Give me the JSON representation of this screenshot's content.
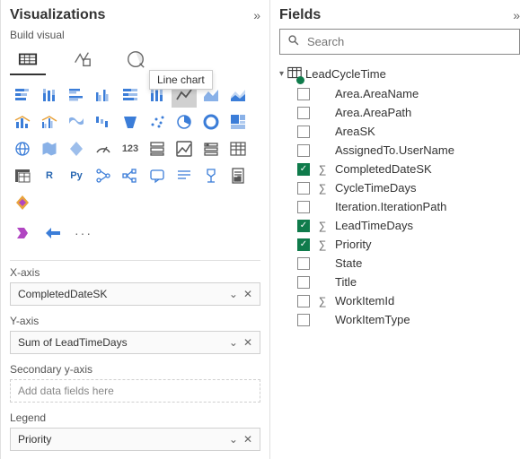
{
  "viz": {
    "title": "Visualizations",
    "subtitle": "Build visual",
    "tooltip": "Line chart",
    "sections": {
      "xaxis": {
        "label": "X-axis",
        "value": "CompletedDateSK"
      },
      "yaxis": {
        "label": "Y-axis",
        "value": "Sum of LeadTimeDays"
      },
      "secy": {
        "label": "Secondary y-axis",
        "placeholder": "Add data fields here"
      },
      "legend": {
        "label": "Legend",
        "value": "Priority"
      }
    }
  },
  "fields": {
    "title": "Fields",
    "search_placeholder": "Search",
    "table": "LeadCycleTime",
    "items": [
      {
        "name": "Area.AreaName",
        "checked": false,
        "agg": false
      },
      {
        "name": "Area.AreaPath",
        "checked": false,
        "agg": false
      },
      {
        "name": "AreaSK",
        "checked": false,
        "agg": false
      },
      {
        "name": "AssignedTo.UserName",
        "checked": false,
        "agg": false
      },
      {
        "name": "CompletedDateSK",
        "checked": true,
        "agg": true
      },
      {
        "name": "CycleTimeDays",
        "checked": false,
        "agg": true
      },
      {
        "name": "Iteration.IterationPath",
        "checked": false,
        "agg": false
      },
      {
        "name": "LeadTimeDays",
        "checked": true,
        "agg": true
      },
      {
        "name": "Priority",
        "checked": true,
        "agg": true
      },
      {
        "name": "State",
        "checked": false,
        "agg": false
      },
      {
        "name": "Title",
        "checked": false,
        "agg": false
      },
      {
        "name": "WorkItemId",
        "checked": false,
        "agg": true
      },
      {
        "name": "WorkItemType",
        "checked": false,
        "agg": false
      }
    ]
  }
}
